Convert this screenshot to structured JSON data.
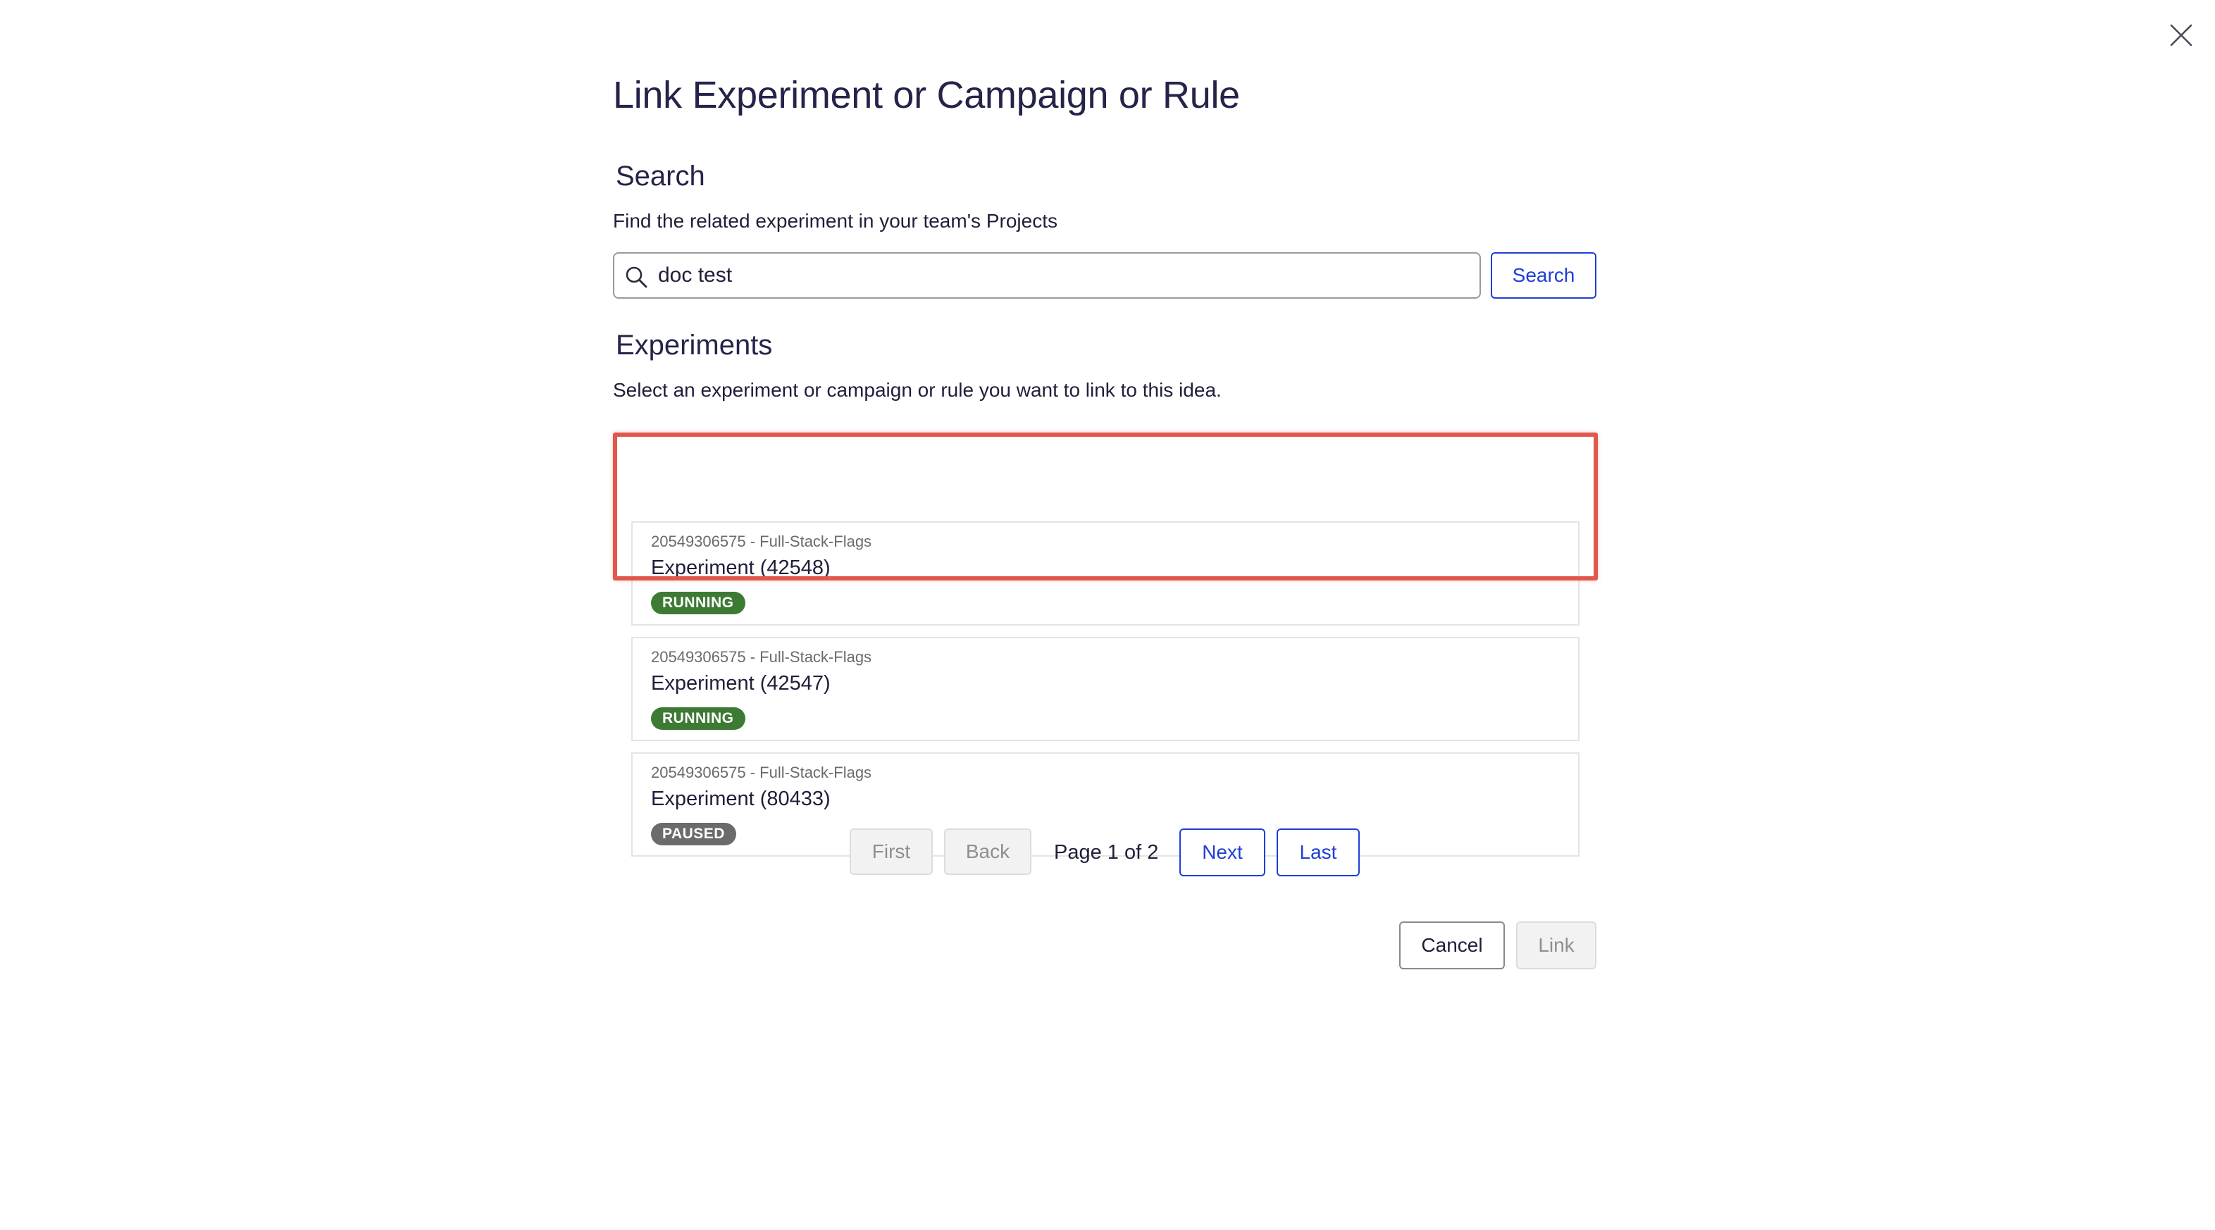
{
  "close_icon": "close-icon",
  "dialog": {
    "title": "Link Experiment or Campaign or Rule",
    "search": {
      "heading": "Search",
      "description": "Find the related experiment in your team's Projects",
      "input_value": "doc test",
      "icon": "search-icon",
      "button_label": "Search"
    },
    "experiments": {
      "heading": "Experiments",
      "description": "Select an experiment or campaign or rule you want to link to this idea.",
      "items": [
        {
          "project": "20549306575 - Full-Stack-Flags",
          "name": "Experiment (42548)",
          "status": "RUNNING",
          "status_color": "#3d7a34",
          "highlighted": true
        },
        {
          "project": "20549306575 - Full-Stack-Flags",
          "name": "Experiment (42547)",
          "status": "RUNNING",
          "status_color": "#3d7a34",
          "highlighted": false
        },
        {
          "project": "20549306575 - Full-Stack-Flags",
          "name": "Experiment (80433)",
          "status": "PAUSED",
          "status_color": "#6b6b6b",
          "highlighted": false
        }
      ]
    },
    "pagination": {
      "first": "First",
      "back": "Back",
      "page_label": "Page 1 of 2",
      "next": "Next",
      "last": "Last"
    },
    "footer": {
      "cancel": "Cancel",
      "link": "Link"
    }
  },
  "colors": {
    "accent": "#1f3fd4",
    "highlight": "#e0574c",
    "running": "#3d7a34",
    "paused": "#6b6b6b"
  }
}
